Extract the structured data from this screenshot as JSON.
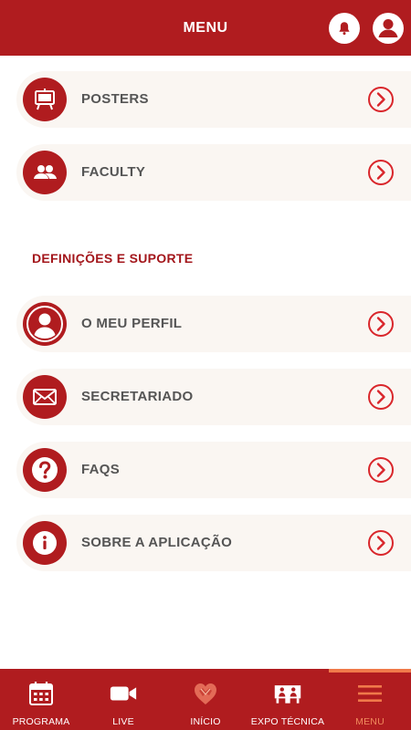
{
  "header": {
    "title": "MENU"
  },
  "menu_items": [
    {
      "label": "POSTERS",
      "icon": "easel-icon"
    },
    {
      "label": "FACULTY",
      "icon": "group-icon"
    }
  ],
  "section": {
    "title": "DEFINIÇÕES E SUPORTE"
  },
  "support_items": [
    {
      "label": "O MEU PERFIL",
      "icon": "user-icon"
    },
    {
      "label": "SECRETARIADO",
      "icon": "mail-icon"
    },
    {
      "label": "FAQS",
      "icon": "question-icon"
    },
    {
      "label": "SOBRE A APLICAÇÃO",
      "icon": "info-icon"
    }
  ],
  "tabbar": {
    "tabs": [
      {
        "label": "PROGRAMA",
        "icon": "calendar-icon"
      },
      {
        "label": "LIVE",
        "icon": "video-camera-icon"
      },
      {
        "label": "INÍCIO",
        "icon": "heart-logo-icon"
      },
      {
        "label": "EXPO TÉCNICA",
        "icon": "expo-icon"
      },
      {
        "label": "MENU",
        "icon": "hamburger-icon",
        "active": true
      }
    ]
  },
  "colors": {
    "primary": "#b01c1f",
    "item_bg": "#faf6f2",
    "accent": "#f07a4a"
  }
}
